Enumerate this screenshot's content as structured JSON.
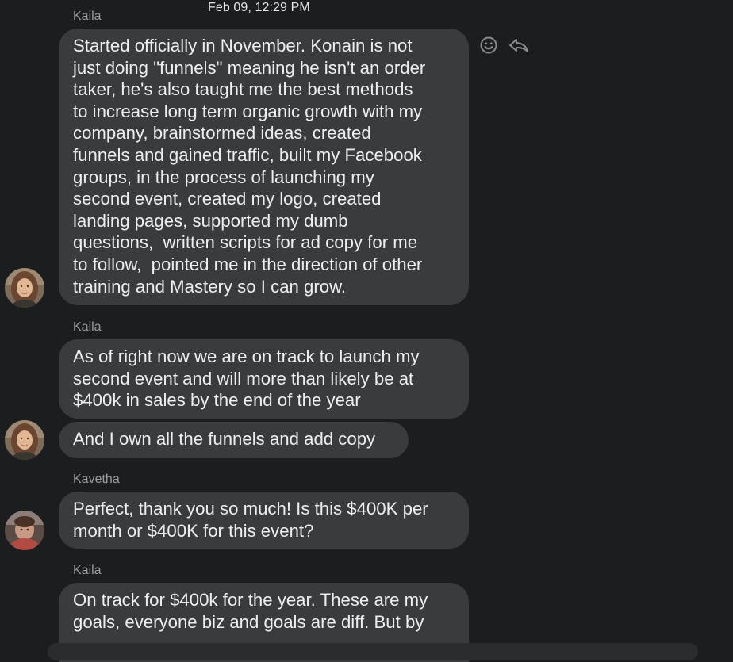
{
  "conversation": {
    "timestamp": "Feb 09, 12:29 PM",
    "groups": [
      {
        "sender": "Kaila",
        "messages": [
          "Started officially in November. Konain is not\njust doing \"funnels\" meaning he isn't an order\ntaker, he's also taught me the best methods\nto increase long term organic growth with my\ncompany, brainstormed ideas, created\nfunnels and gained traffic, built my Facebook\ngroups, in the process of launching my\nsecond event, created my logo, created\nlanding pages, supported my dumb\nquestions,  written scripts for ad copy for me\nto follow,  pointed me in the direction of other\ntraining and Mastery so I can grow."
        ]
      },
      {
        "sender": "Kaila",
        "messages": [
          "As of right now we are on track to launch my\nsecond event and will more than likely be at\n$400k in sales by the end of the year",
          "And I own all the funnels and add copy"
        ]
      },
      {
        "sender": "Kavetha",
        "messages": [
          "Perfect, thank you so much! Is this $400K per\nmonth or $400K for this event?"
        ]
      },
      {
        "sender": "Kaila",
        "messages": [
          "On track for $400k for the year. These are my\ngoals, everyone biz and goals are diff. But by"
        ]
      }
    ]
  },
  "message_actions": {
    "react_icon": "smiley-icon",
    "reply_icon": "reply-icon"
  },
  "colors": {
    "background": "#1c1d1f",
    "bubble": "#3a3b3d",
    "bubble_text": "#eceef1",
    "sender_name": "#9b9da2"
  }
}
